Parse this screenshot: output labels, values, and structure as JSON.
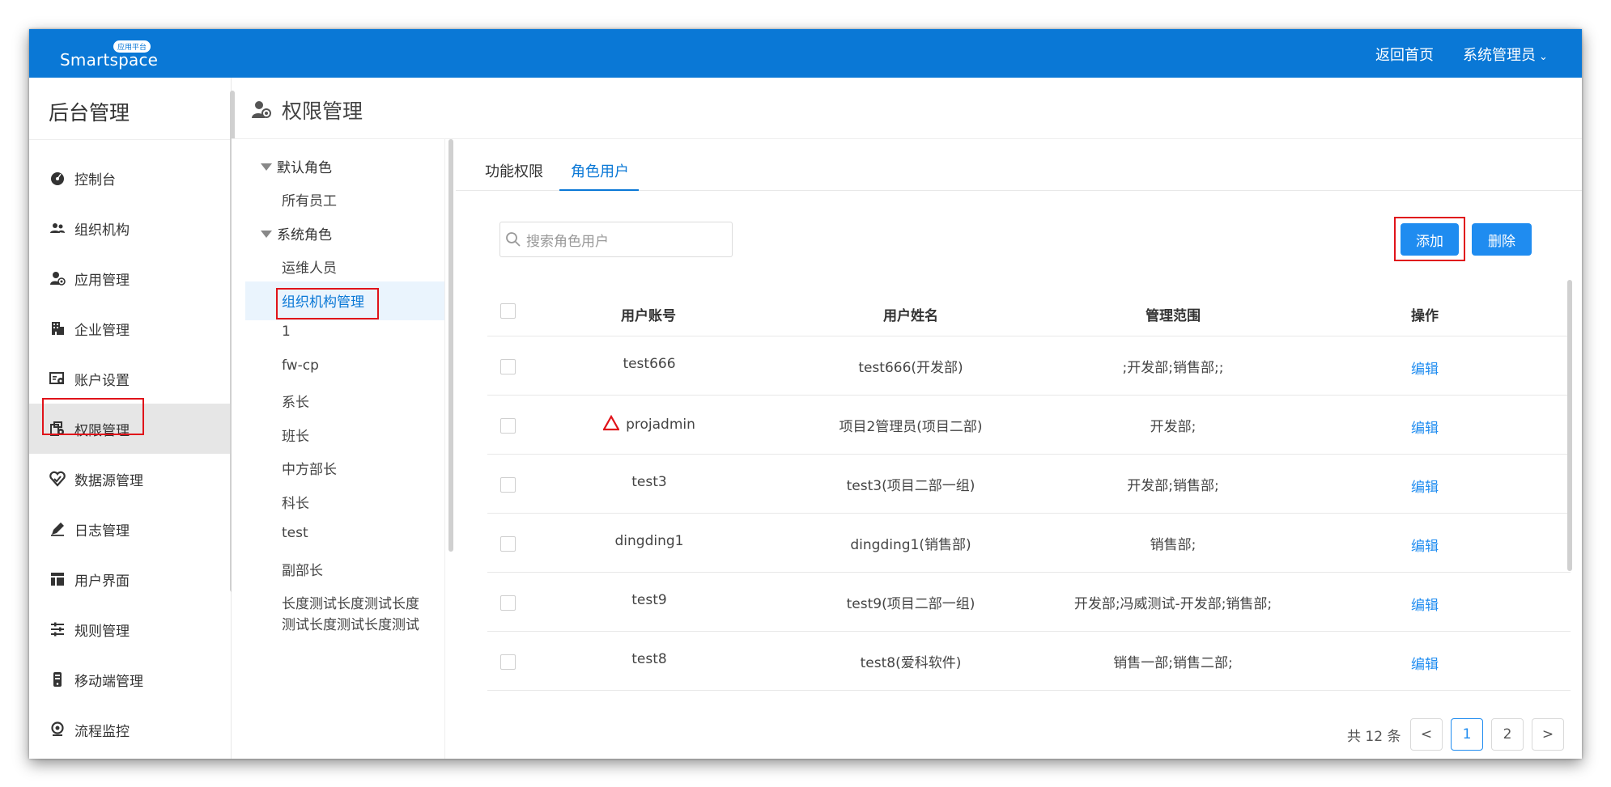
{
  "topbar": {
    "logo_text": "Smartspace",
    "logo_tag": "应用平台",
    "home_link": "返回首页",
    "user_menu": "系统管理员"
  },
  "sidebar": {
    "title": "后台管理",
    "items": [
      {
        "label": "控制台",
        "icon": "dashboard-icon"
      },
      {
        "label": "组织机构",
        "icon": "org-icon"
      },
      {
        "label": "应用管理",
        "icon": "app-user-icon"
      },
      {
        "label": "企业管理",
        "icon": "building-icon"
      },
      {
        "label": "账户设置",
        "icon": "account-settings-icon"
      },
      {
        "label": "权限管理",
        "icon": "permission-icon"
      },
      {
        "label": "数据源管理",
        "icon": "datasource-icon"
      },
      {
        "label": "日志管理",
        "icon": "log-icon"
      },
      {
        "label": "用户界面",
        "icon": "layout-icon"
      },
      {
        "label": "规则管理",
        "icon": "rules-icon"
      },
      {
        "label": "移动端管理",
        "icon": "mobile-icon"
      },
      {
        "label": "流程监控",
        "icon": "monitor-icon"
      }
    ],
    "active_index": 5
  },
  "header": {
    "title": "权限管理"
  },
  "role_tree": {
    "groups": [
      {
        "label": "默认角色",
        "items": [
          "所有员工"
        ]
      },
      {
        "label": "系统角色",
        "items": [
          "运维人员",
          "组织机构管理",
          "1",
          "fw-cp",
          "系长",
          "班长",
          "中方部长",
          "科长",
          "test",
          "副部长",
          "长度测试长度测试长度",
          "测试长度测试长度测试"
        ]
      }
    ],
    "selected": "组织机构管理"
  },
  "tabs": [
    {
      "label": "功能权限",
      "active": false
    },
    {
      "label": "角色用户",
      "active": true
    }
  ],
  "search": {
    "placeholder": "搜索角色用户"
  },
  "actions": {
    "add_label": "添加",
    "delete_label": "删除"
  },
  "table": {
    "headers": [
      "用户账号",
      "用户姓名",
      "管理范围",
      "操作"
    ],
    "rows": [
      {
        "account": "test666",
        "name": "test666(开发部)",
        "scope": ";开发部;销售部;;",
        "action": "编辑",
        "warning": false
      },
      {
        "account": "projadmin",
        "name": "项目2管理员(项目二部)",
        "scope": "开发部;",
        "action": "编辑",
        "warning": true
      },
      {
        "account": "test3",
        "name": "test3(项目二部一组)",
        "scope": "开发部;销售部;",
        "action": "编辑",
        "warning": false
      },
      {
        "account": "dingding1",
        "name": "dingding1(销售部)",
        "scope": "销售部;",
        "action": "编辑",
        "warning": false
      },
      {
        "account": "test9",
        "name": "test9(项目二部一组)",
        "scope": "开发部;冯威测试-开发部;销售部;",
        "action": "编辑",
        "warning": false
      },
      {
        "account": "test8",
        "name": "test8(爱科软件)",
        "scope": "销售一部;销售二部;",
        "action": "编辑",
        "warning": false
      }
    ]
  },
  "pagination": {
    "total_text": "共 12 条",
    "pages": [
      "1",
      "2"
    ],
    "current": "1",
    "prev": "<",
    "next": ">"
  },
  "colors": {
    "primary": "#0a78d6",
    "button": "#1f8cf0",
    "highlight_box": "#e0131a"
  }
}
